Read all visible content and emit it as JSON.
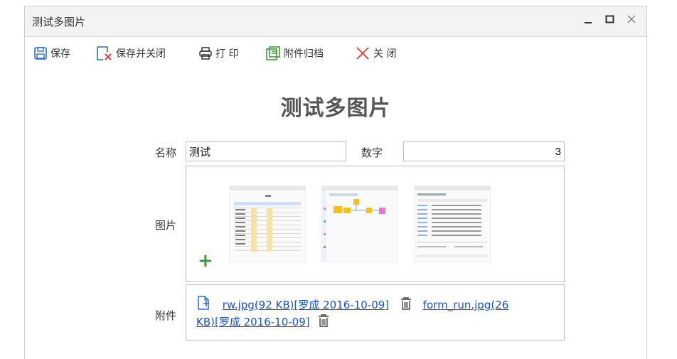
{
  "window": {
    "title": "测试多图片"
  },
  "toolbar": {
    "save": "保存",
    "save_close": "保存并关闭",
    "print": "打 印",
    "archive": "附件归档",
    "close": "关 闭"
  },
  "form": {
    "heading": "测试多图片",
    "name_label": "名称",
    "name_value": "测试",
    "number_label": "数字",
    "number_value": "3",
    "images_label": "图片",
    "add_symbol": "+",
    "attachments_label": "附件",
    "attachments": [
      {
        "text": "rw.jpg(92 KB)[罗成 2016-10-09]"
      },
      {
        "text_line1": "form_run.jpg(26",
        "text_line2": "KB)[罗成 2016-10-09]"
      }
    ]
  },
  "colors": {
    "accent_green": "#3c9a3c",
    "accent_blue": "#2a6bd1",
    "close_red": "#e23b3b",
    "link": "#1a53c6"
  },
  "icons": [
    "save-icon",
    "save-close-icon",
    "print-icon",
    "archive-icon",
    "close-x-icon",
    "add-file-icon",
    "trash-icon",
    "minimize-icon",
    "maximize-icon",
    "window-close-icon"
  ]
}
